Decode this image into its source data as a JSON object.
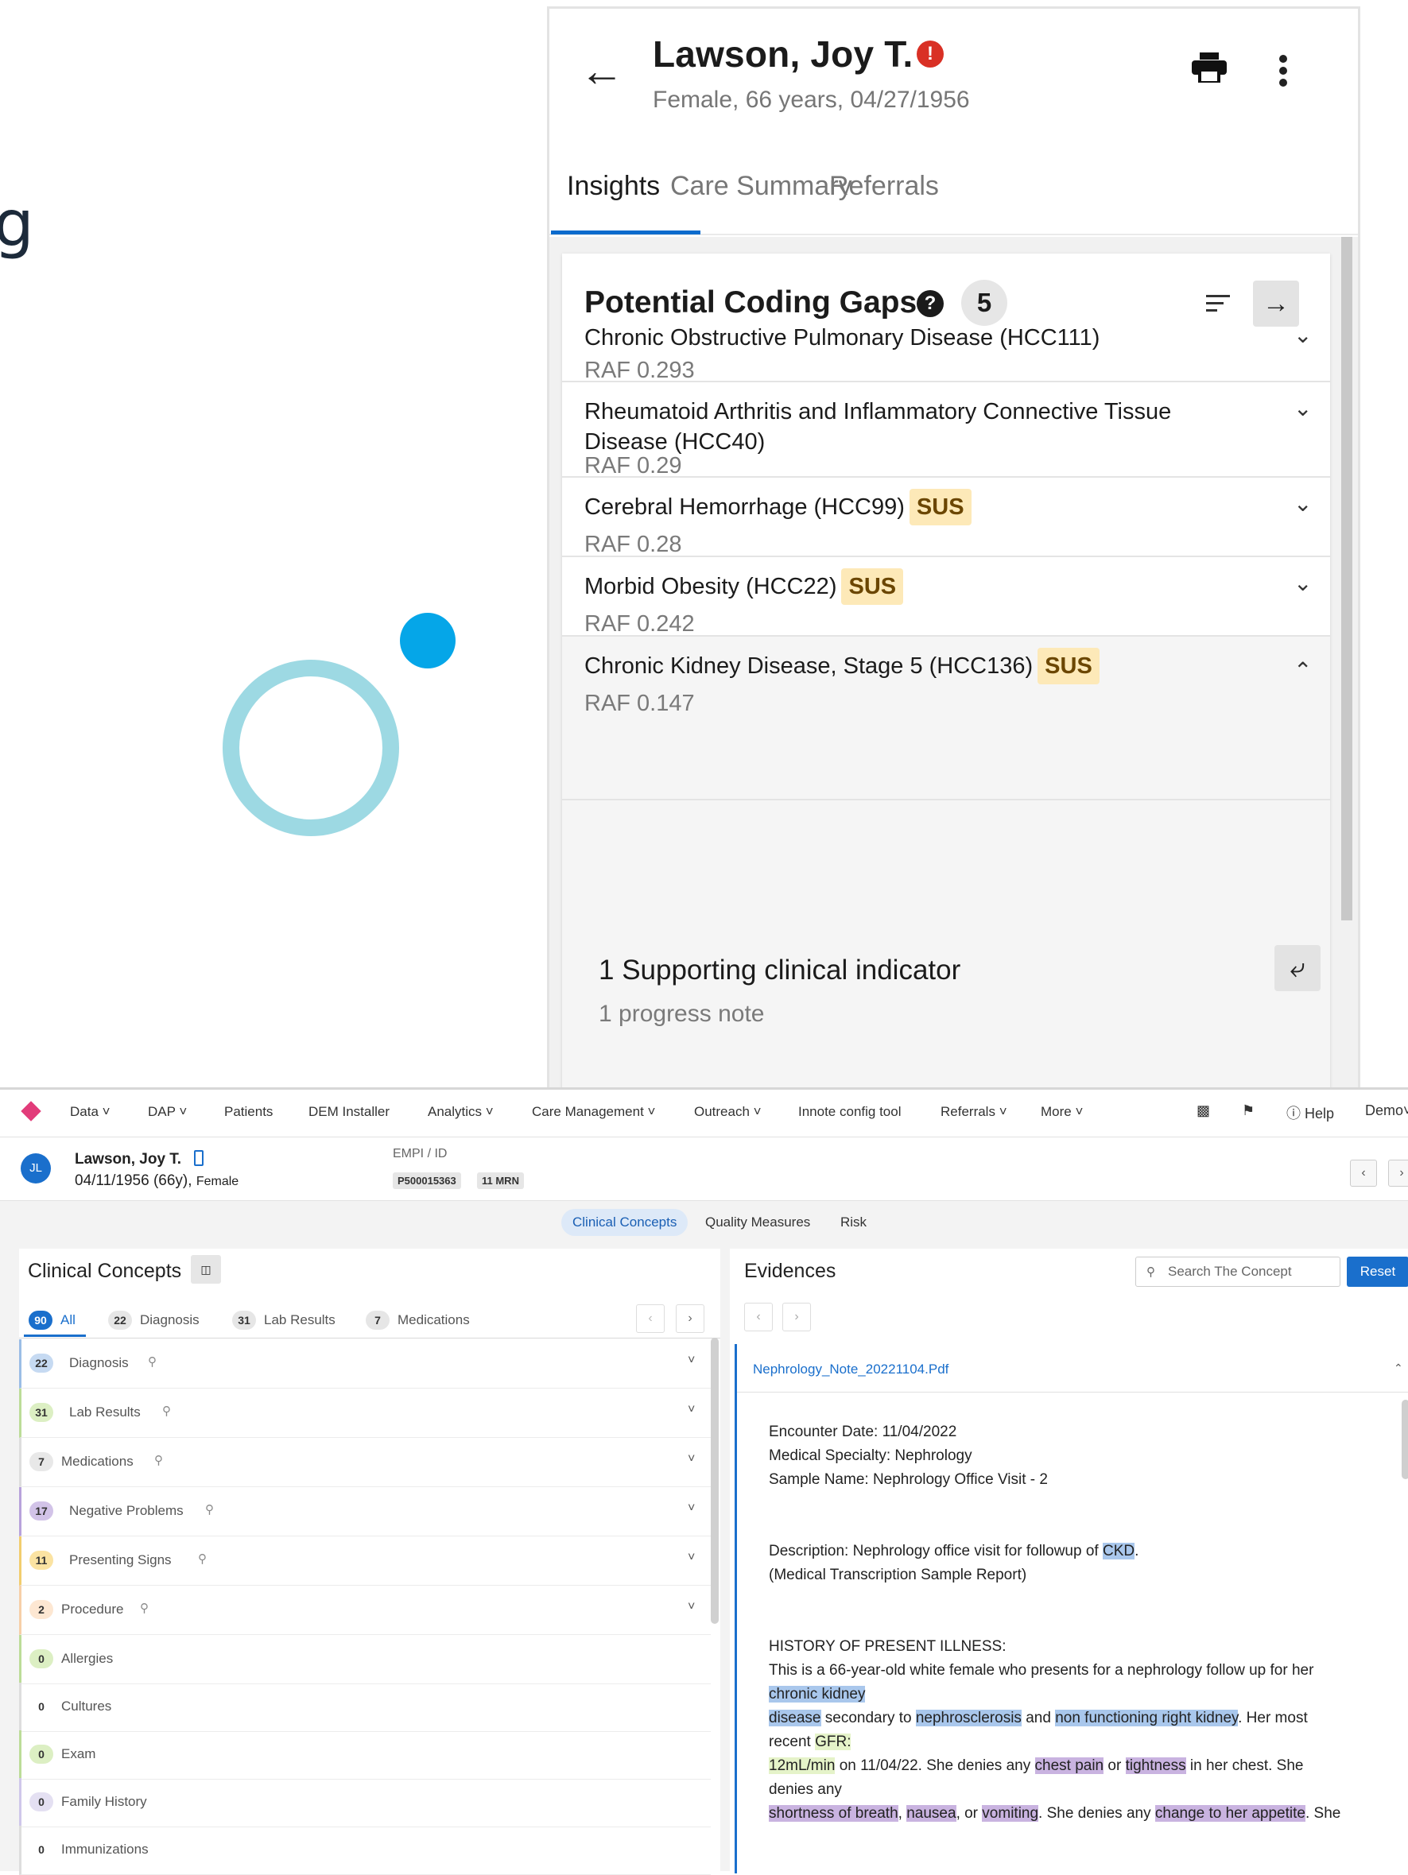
{
  "decor": {
    "partial_letter": "g"
  },
  "mobile": {
    "patient_name": "Lawson, Joy T.",
    "alert_icon_text": "!",
    "patient_info": "Female, 66 years, 04/27/1956",
    "tabs": [
      "Insights",
      "Care Summary",
      "Referrals"
    ],
    "active_tab": "Insights",
    "card": {
      "title": "Potential Coding Gaps",
      "help_icon_text": "?",
      "count": "5",
      "gaps": [
        {
          "title": "Chronic Obstructive Pulmonary Disease (HCC111)",
          "raf": "RAF 0.293",
          "sus": "",
          "expanded": false
        },
        {
          "title": "Rheumatoid Arthritis and Inflammatory Connective Tissue Disease (HCC40)",
          "raf": "RAF 0.29",
          "sus": "",
          "expanded": false
        },
        {
          "title": "Cerebral Hemorrhage (HCC99)",
          "raf": "RAF 0.28",
          "sus": "SUS",
          "expanded": false
        },
        {
          "title": "Morbid Obesity (HCC22)",
          "raf": "RAF 0.242",
          "sus": "SUS",
          "expanded": false
        },
        {
          "title": "Chronic Kidney Disease, Stage 5 (HCC136)",
          "raf": "RAF 0.147",
          "sus": "SUS",
          "expanded": true
        }
      ],
      "supporting_indicator": "1 Supporting clinical indicator",
      "supporting_sub": "1 progress note"
    }
  },
  "desktop": {
    "nav": [
      "Data",
      "DAP",
      "Patients",
      "DEM Installer",
      "Analytics",
      "Care Management",
      "Outreach",
      "Innote config tool",
      "Referrals",
      "More"
    ],
    "nav_right": {
      "help": "Help",
      "user": "Demo"
    },
    "patient": {
      "initials": "JL",
      "name": "Lawson, Joy T.",
      "dob": "04/11/1956 (66y),",
      "sex": "Female",
      "empi_label": "EMPI / ID",
      "empi": "P500015363",
      "mrn": "11 MRN"
    },
    "subtabs": [
      "Clinical Concepts",
      "Quality Measures",
      "Risk"
    ],
    "active_subtab": "Clinical Concepts",
    "clinical_concepts": {
      "title": "Clinical Concepts",
      "filters": [
        {
          "count": "90",
          "label": "All"
        },
        {
          "count": "22",
          "label": "Diagnosis"
        },
        {
          "count": "31",
          "label": "Lab Results"
        },
        {
          "count": "7",
          "label": "Medications"
        }
      ],
      "rows": [
        {
          "count": "22",
          "label": "Diagnosis",
          "color": "#c6daf2",
          "border": "#9bbde6",
          "searchable": true,
          "expandable": true
        },
        {
          "count": "31",
          "label": "Lab Results",
          "color": "#dcefc3",
          "border": "#bcdc98",
          "searchable": true,
          "expandable": true
        },
        {
          "count": "7",
          "label": "Medications",
          "color": "#e8e8e8",
          "border": "#dddddd",
          "searchable": true,
          "expandable": true
        },
        {
          "count": "17",
          "label": "Negative Problems",
          "color": "#d2c3e8",
          "border": "#b8a2db",
          "searchable": true,
          "expandable": true
        },
        {
          "count": "11",
          "label": "Presenting Signs",
          "color": "#fbe3a2",
          "border": "#f2cd6e",
          "searchable": true,
          "expandable": true
        },
        {
          "count": "2",
          "label": "Procedure",
          "color": "#fde7d2",
          "border": "#f6cfa8",
          "searchable": true,
          "expandable": true
        },
        {
          "count": "0",
          "label": "Allergies",
          "color": "#dcefc3",
          "border": "#bcdc98",
          "searchable": false,
          "expandable": false
        },
        {
          "count": "0",
          "label": "Cultures",
          "color": "#ffffff",
          "border": "#dddddd",
          "searchable": false,
          "expandable": false
        },
        {
          "count": "0",
          "label": "Exam",
          "color": "#dcefc3",
          "border": "#bcdc98",
          "searchable": false,
          "expandable": false
        },
        {
          "count": "0",
          "label": "Family History",
          "color": "#e4e0f2",
          "border": "#cfc7ea",
          "searchable": false,
          "expandable": false
        },
        {
          "count": "0",
          "label": "Immunizations",
          "color": "#ffffff",
          "border": "#dddddd",
          "searchable": false,
          "expandable": false
        }
      ]
    },
    "evidences": {
      "title": "Evidences",
      "search_placeholder": "Search The Concept",
      "reset": "Reset",
      "file": "Nephrology_Note_20221104.Pdf",
      "text": {
        "encounter": "Encounter Date: 11/04/2022",
        "specialty": "Medical Specialty: Nephrology",
        "sample": "Sample Name: Nephrology Office Visit - 2",
        "desc_a": "Description: Nephrology office visit for followup of ",
        "desc_ckd": "CKD",
        "desc_b": ".",
        "desc_sample": "(Medical Transcription Sample Report)",
        "hpi_heading": "HISTORY OF PRESENT ILLNESS:",
        "hpi_1": "This is a 66-year-old white female who presents for a nephrology follow up for her",
        "hl_chronic_kidney": "chronic kidney",
        "hl_disease": "disease",
        "t_secondary": " secondary to ",
        "hl_nephrosclerosis": "nephrosclerosis",
        "t_and": " and ",
        "hl_nonfunc": "non functioning right kidney",
        "t_her_most": ". Her most",
        "t_recent": "recent ",
        "hl_gfr": "GFR:",
        "hl_12ml": "12mL/min",
        "t_on": " on 11/04/22. She denies any ",
        "hl_chest": "chest pain",
        "t_or": " or ",
        "hl_tight": "tightness",
        "t_in_chest": " in her chest. She",
        "t_denies_any": "denies any",
        "hl_sob": "shortness of breath",
        "t_comma1": ", ",
        "hl_nausea": "nausea",
        "t_or2": ", or ",
        "hl_vomiting": "vomiting",
        "t_she_denies": ". She denies any ",
        "hl_appetite": "change to her appetite",
        "t_she": ". She"
      }
    }
  }
}
